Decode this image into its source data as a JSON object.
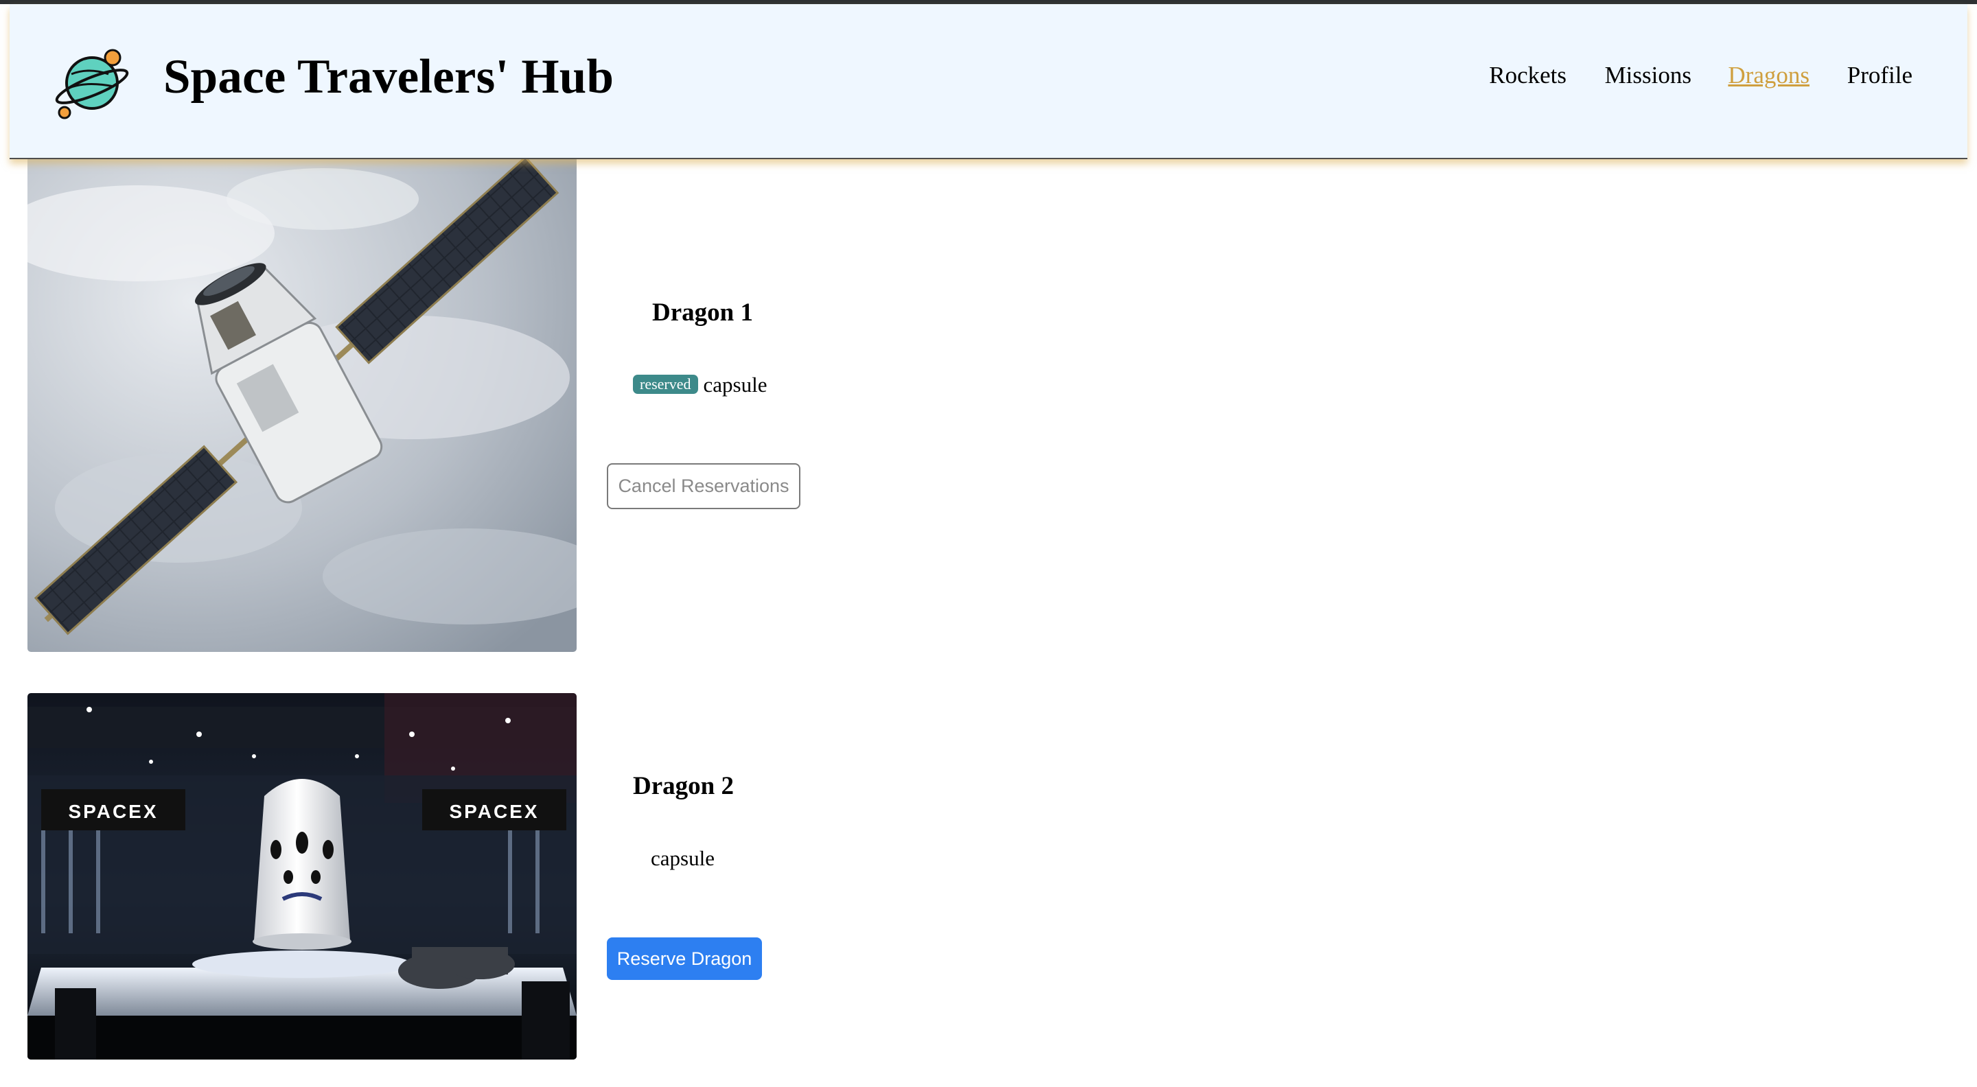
{
  "header": {
    "title": "Space Travelers' Hub",
    "logo_icon": "planet-icon",
    "nav": [
      {
        "label": "Rockets",
        "active": false
      },
      {
        "label": "Missions",
        "active": false
      },
      {
        "label": "Dragons",
        "active": true
      },
      {
        "label": "Profile",
        "active": false
      }
    ]
  },
  "colors": {
    "header_bg": "#eff7ff",
    "active_link": "#cf9f3e",
    "badge": "#3d8a8a",
    "reserve_button": "#2d7ff1"
  },
  "dragons": [
    {
      "name": "Dragon 1",
      "badge": "reserved",
      "type": "capsule",
      "button": "Cancel Reservations",
      "reserved": true,
      "image": "dragon-in-orbit-photo"
    },
    {
      "name": "Dragon 2",
      "badge": "",
      "type": "capsule",
      "button": "Reserve Dragon",
      "reserved": false,
      "image": "dragon-2-display-photo",
      "image_text": "SPACEX"
    }
  ]
}
